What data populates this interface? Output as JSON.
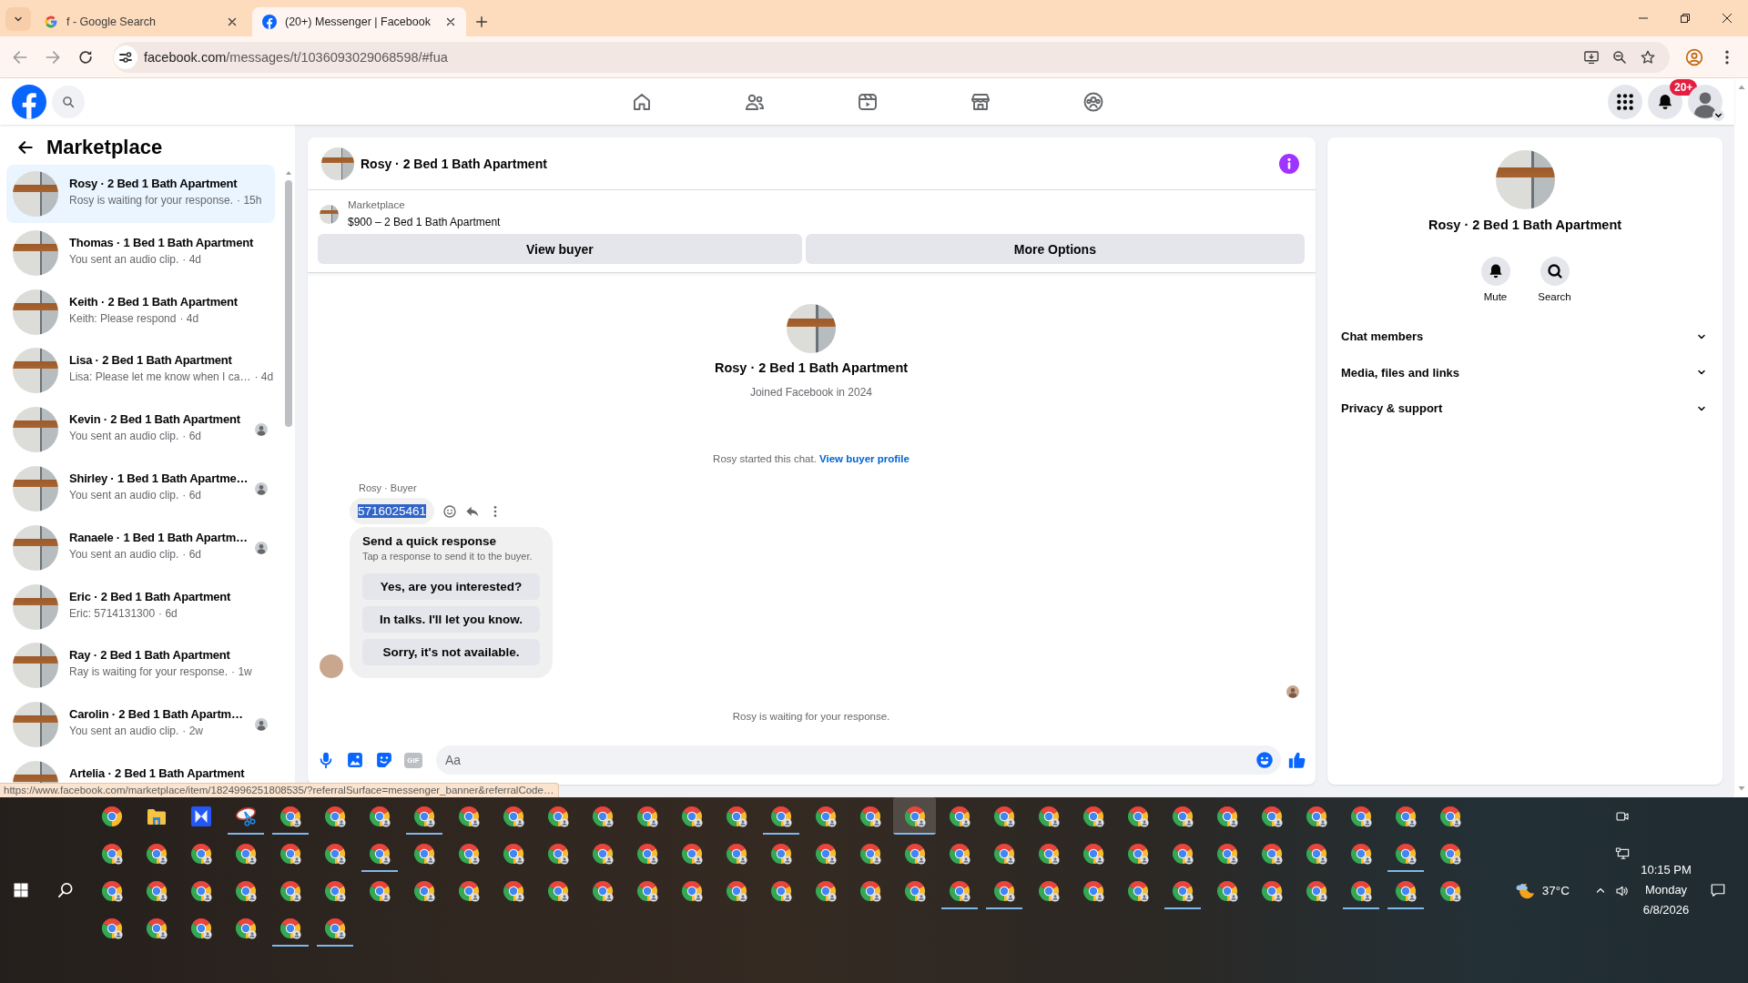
{
  "browser": {
    "tabs": [
      {
        "kind": "google",
        "title": "f - Google Search",
        "selected": false
      },
      {
        "kind": "facebook",
        "title": "(20+) Messenger | Facebook",
        "selected": true
      }
    ],
    "url": "facebook.com/messages/t/1036093029068598/#fua"
  },
  "header": {
    "nav": [
      {
        "kind": "home"
      },
      {
        "kind": "friends"
      },
      {
        "kind": "video"
      },
      {
        "kind": "marketplace"
      },
      {
        "kind": "groups"
      }
    ],
    "notification_badge": "20+"
  },
  "sidebar": {
    "title": "Marketplace",
    "conversations": [
      {
        "name": "Rosy · 2 Bed 1 Bath Apartment",
        "preview": "Rosy is waiting for your response.",
        "time": "· 15h",
        "selected": true,
        "seen": false
      },
      {
        "name": "Thomas · 1 Bed 1 Bath Apartment",
        "preview": "You sent an audio clip.",
        "time": "· 4d",
        "selected": false,
        "seen": false
      },
      {
        "name": "Keith · 2 Bed 1 Bath Apartment",
        "preview": "Keith: Please respond",
        "time": "· 4d",
        "selected": false,
        "seen": false
      },
      {
        "name": "Lisa · 2 Bed 1 Bath Apartment",
        "preview": "Lisa: Please let me know when I ca…",
        "time": "· 4d",
        "selected": false,
        "seen": false
      },
      {
        "name": "Kevin · 2 Bed 1 Bath Apartment",
        "preview": "You sent an audio clip.",
        "time": "· 6d",
        "selected": false,
        "seen": true
      },
      {
        "name": "Shirley · 1 Bed 1 Bath Apartme…",
        "preview": "You sent an audio clip.",
        "time": "· 6d",
        "selected": false,
        "seen": true
      },
      {
        "name": "Ranaele · 1 Bed 1 Bath Apartm…",
        "preview": "You sent an audio clip.",
        "time": "· 6d",
        "selected": false,
        "seen": true
      },
      {
        "name": "Eric · 2 Bed 1 Bath Apartment",
        "preview": "Eric: 5714131300",
        "time": "· 6d",
        "selected": false,
        "seen": false
      },
      {
        "name": "Ray · 2 Bed 1 Bath Apartment",
        "preview": "Ray is waiting for your response.",
        "time": "· 1w",
        "selected": false,
        "seen": false
      },
      {
        "name": "Carolin · 2 Bed 1 Bath Apartm…",
        "preview": "You sent an audio clip.",
        "time": "· 2w",
        "selected": false,
        "seen": true
      },
      {
        "name": "Artelia · 2 Bed 1 Bath Apartment",
        "selected": false,
        "seen": false
      }
    ]
  },
  "chat": {
    "title": "Rosy · 2 Bed 1 Bath Apartment",
    "listing": {
      "label": "Marketplace",
      "title": "$900 – 2 Bed 1 Bath Apartment"
    },
    "actions": [
      "View buyer",
      "More Options"
    ],
    "profile": {
      "name": "Rosy · 2 Bed 1 Bath Apartment",
      "joined": "Joined Facebook in 2024"
    },
    "intro": {
      "text": "Rosy started this chat.",
      "link": "View buyer profile"
    },
    "sender": "Rosy · Buyer",
    "message": {
      "text": "5716025461",
      "highlighted": true
    },
    "quick_response": {
      "title": "Send a quick response",
      "hint": "Tap a response to send it to the buyer.",
      "options": [
        "Yes, are you interested?",
        "In talks. I'll let you know.",
        "Sorry, it's not available."
      ]
    },
    "status": "Rosy is waiting for your response.",
    "composer": {
      "gif": "GIF",
      "placeholder": "Aa"
    }
  },
  "details": {
    "name": "Rosy · 2 Bed 1 Bath Apartment",
    "actions": [
      {
        "kind": "mute",
        "label": "Mute"
      },
      {
        "kind": "search",
        "label": "Search"
      }
    ],
    "sections": [
      {
        "label": "Chat members",
        "expanded": false
      },
      {
        "label": "Media, files and links",
        "expanded": false
      },
      {
        "label": "Privacy & support",
        "expanded": false
      }
    ]
  },
  "status_url": "https://www.facebook.com/marketplace/item/1824996251808535/?referralSurface=messenger_banner&referralCode…",
  "taskbar": {
    "apps": [
      {
        "kind": "chrome",
        "open": false,
        "selected": false
      },
      {
        "kind": "folder",
        "open": false,
        "selected": false
      },
      {
        "kind": "tile",
        "open": false,
        "selected": false
      },
      {
        "kind": "scissors",
        "open": true,
        "selected": false
      },
      {
        "kind": "chrome-profile",
        "open": true,
        "selected": false
      },
      {
        "kind": "chrome-profile",
        "open": false,
        "selected": false
      },
      {
        "kind": "chrome-profile",
        "open": false,
        "selected": false
      },
      {
        "kind": "chrome-profile",
        "open": true,
        "selected": false
      },
      {
        "kind": "chrome-profile",
        "open": false,
        "selected": false
      },
      {
        "kind": "chrome-profile",
        "open": false,
        "selected": false
      },
      {
        "kind": "chrome-profile",
        "open": false,
        "selected": false
      },
      {
        "kind": "chrome-profile",
        "open": false,
        "selected": false
      },
      {
        "kind": "chrome-profile",
        "open": false,
        "selected": false
      },
      {
        "kind": "chrome-profile",
        "open": false,
        "selected": false
      },
      {
        "kind": "chrome-profile",
        "open": false,
        "selected": false
      },
      {
        "kind": "chrome-profile",
        "open": true,
        "selected": false
      },
      {
        "kind": "chrome-profile",
        "open": false,
        "selected": false
      },
      {
        "kind": "chrome-profile",
        "open": false,
        "selected": false
      },
      {
        "kind": "chrome-profile",
        "open": true,
        "selected": true
      },
      {
        "kind": "chrome-profile",
        "open": false,
        "selected": false
      },
      {
        "kind": "chrome-profile",
        "open": false,
        "selected": false
      },
      {
        "kind": "chrome-profile",
        "open": false,
        "selected": false
      },
      {
        "kind": "chrome-profile",
        "open": false,
        "selected": false
      },
      {
        "kind": "chrome-profile",
        "open": false,
        "selected": false
      },
      {
        "kind": "chrome-profile",
        "open": false,
        "selected": false
      },
      {
        "kind": "chrome-profile",
        "open": false,
        "selected": false
      },
      {
        "kind": "chrome-profile",
        "open": false,
        "selected": false
      },
      {
        "kind": "chrome-profile",
        "open": false,
        "selected": false
      },
      {
        "kind": "chrome-profile",
        "open": false,
        "selected": false
      },
      {
        "kind": "chrome-profile",
        "open": false,
        "selected": false
      },
      {
        "kind": "chrome-profile",
        "open": false,
        "selected": false
      },
      {
        "kind": "chrome-profile",
        "open": false,
        "selected": false
      },
      {
        "kind": "chrome-profile",
        "open": false,
        "selected": false
      },
      {
        "kind": "chrome-profile",
        "open": false,
        "selected": false
      },
      {
        "kind": "chrome-profile",
        "open": false,
        "selected": false
      },
      {
        "kind": "chrome-profile",
        "open": false,
        "selected": false
      },
      {
        "kind": "chrome-profile",
        "open": false,
        "selected": false
      },
      {
        "kind": "chrome-profile",
        "open": true,
        "selected": false
      },
      {
        "kind": "chrome-profile",
        "open": false,
        "selected": false
      },
      {
        "kind": "chrome-profile",
        "open": false,
        "selected": false
      },
      {
        "kind": "chrome-profile",
        "open": false,
        "selected": false
      },
      {
        "kind": "chrome-profile",
        "open": false,
        "selected": false
      },
      {
        "kind": "chrome-profile",
        "open": false,
        "selected": false
      },
      {
        "kind": "chrome-profile",
        "open": false,
        "selected": false
      },
      {
        "kind": "chrome-profile",
        "open": false,
        "selected": false
      },
      {
        "kind": "chrome-profile",
        "open": false,
        "selected": false
      },
      {
        "kind": "chrome-profile",
        "open": false,
        "selected": false
      },
      {
        "kind": "chrome-profile",
        "open": false,
        "selected": false
      },
      {
        "kind": "chrome-profile",
        "open": false,
        "selected": false
      },
      {
        "kind": "chrome-profile",
        "open": false,
        "selected": false
      },
      {
        "kind": "chrome-profile",
        "open": false,
        "selected": false
      },
      {
        "kind": "chrome-profile",
        "open": false,
        "selected": false
      },
      {
        "kind": "chrome-profile",
        "open": false,
        "selected": false
      },
      {
        "kind": "chrome-profile",
        "open": false,
        "selected": false
      },
      {
        "kind": "chrome-profile",
        "open": false,
        "selected": false
      },
      {
        "kind": "chrome-profile",
        "open": false,
        "selected": false
      },
      {
        "kind": "chrome-profile",
        "open": false,
        "selected": false
      },
      {
        "kind": "chrome-profile",
        "open": false,
        "selected": false
      },
      {
        "kind": "chrome-profile",
        "open": false,
        "selected": false
      },
      {
        "kind": "chrome-profile",
        "open": false,
        "selected": false
      },
      {
        "kind": "chrome-profile",
        "open": true,
        "selected": false
      },
      {
        "kind": "chrome-profile",
        "open": false,
        "selected": false
      },
      {
        "kind": "chrome-profile",
        "open": false,
        "selected": false
      },
      {
        "kind": "chrome-profile",
        "open": false,
        "selected": false
      },
      {
        "kind": "chrome-profile",
        "open": false,
        "selected": false
      },
      {
        "kind": "chrome-profile",
        "open": false,
        "selected": false
      },
      {
        "kind": "chrome-profile",
        "open": false,
        "selected": false
      },
      {
        "kind": "chrome-profile",
        "open": false,
        "selected": false
      },
      {
        "kind": "chrome-profile",
        "open": false,
        "selected": false
      },
      {
        "kind": "chrome-profile",
        "open": false,
        "selected": false
      },
      {
        "kind": "chrome-profile",
        "open": false,
        "selected": false
      },
      {
        "kind": "chrome-profile",
        "open": false,
        "selected": false
      },
      {
        "kind": "chrome-profile",
        "open": false,
        "selected": false
      },
      {
        "kind": "chrome-profile",
        "open": false,
        "selected": false
      },
      {
        "kind": "chrome-profile",
        "open": false,
        "selected": false
      },
      {
        "kind": "chrome-profile",
        "open": false,
        "selected": false
      },
      {
        "kind": "chrome-profile",
        "open": false,
        "selected": false
      },
      {
        "kind": "chrome-profile",
        "open": false,
        "selected": false
      },
      {
        "kind": "chrome-profile",
        "open": false,
        "selected": false
      },
      {
        "kind": "chrome-profile",
        "open": false,
        "selected": false
      },
      {
        "kind": "chrome-profile",
        "open": false,
        "selected": false
      },
      {
        "kind": "chrome-profile",
        "open": true,
        "selected": false
      },
      {
        "kind": "chrome-profile",
        "open": true,
        "selected": false
      },
      {
        "kind": "chrome-profile",
        "open": false,
        "selected": false
      },
      {
        "kind": "chrome-profile",
        "open": false,
        "selected": false
      },
      {
        "kind": "chrome-profile",
        "open": false,
        "selected": false
      },
      {
        "kind": "chrome-profile",
        "open": true,
        "selected": false
      },
      {
        "kind": "chrome-profile",
        "open": false,
        "selected": false
      },
      {
        "kind": "chrome-profile",
        "open": false,
        "selected": false
      },
      {
        "kind": "chrome-profile",
        "open": false,
        "selected": false
      },
      {
        "kind": "chrome-profile",
        "open": true,
        "selected": false
      },
      {
        "kind": "chrome-profile",
        "open": true,
        "selected": false
      },
      {
        "kind": "chrome-profile",
        "open": false,
        "selected": false
      },
      {
        "kind": "chrome-profile",
        "open": false,
        "selected": false
      },
      {
        "kind": "chrome-profile",
        "open": false,
        "selected": false
      },
      {
        "kind": "chrome-profile",
        "open": false,
        "selected": false
      },
      {
        "kind": "chrome-profile",
        "open": false,
        "selected": false
      },
      {
        "kind": "chrome-profile",
        "open": true,
        "selected": false
      },
      {
        "kind": "chrome-profile",
        "open": true,
        "selected": false
      }
    ],
    "weather": "37°C",
    "time": "10:15 PM",
    "day": "Monday",
    "date": "6/8/2026"
  }
}
